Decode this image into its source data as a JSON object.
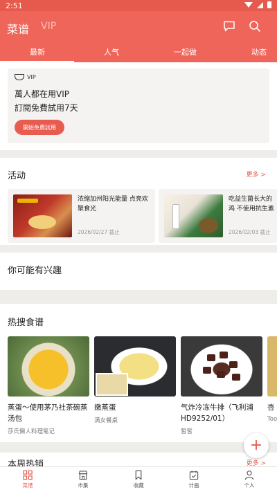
{
  "status_bar": {
    "time": "2:51"
  },
  "header": {
    "title": "菜谱",
    "vip_tab": "VIP"
  },
  "tabs": [
    {
      "label": "最新"
    },
    {
      "label": "人气"
    },
    {
      "label": "一起做"
    },
    {
      "label": "动态"
    }
  ],
  "vip_card": {
    "logo_text": "VIP",
    "line1": "萬人都在用VIP",
    "line2": "訂閱免費試用7天",
    "button": "開始免費試用"
  },
  "activities": {
    "title": "活动",
    "more": "更多 >",
    "items": [
      {
        "text": "浓缩加州阳光能量 点亮欢聚食光",
        "date": "2026/02/27 截止"
      },
      {
        "text": "吃益生菌长大的鸡 不使用抗生素",
        "date": "2026/02/03 截止"
      }
    ]
  },
  "interest": {
    "title": "你可能有兴趣"
  },
  "hot_search": {
    "title": "热搜食谱",
    "items": [
      {
        "name": "蒸蛋～使用茅乃社茶碗蒸汤包",
        "author": "莎氏懒人料理笔记"
      },
      {
        "name": "嫩蒸蛋",
        "author": "满女餐桌"
      },
      {
        "name": "气炸冷冻牛排（飞利浦 HD9252/01）",
        "author": "皙皙"
      },
      {
        "name": "杏",
        "author": "Too"
      }
    ]
  },
  "week_section": {
    "title": "本周热销",
    "more": "更多 >"
  },
  "fab": {
    "label": "+"
  },
  "bottom_nav": [
    {
      "label": "菜谱"
    },
    {
      "label": "市集"
    },
    {
      "label": "收藏"
    },
    {
      "label": "计画"
    },
    {
      "label": "个人"
    }
  ],
  "colors": {
    "accent": "#f0655a",
    "status_bar": "#e65a4d",
    "background": "#efedea"
  }
}
